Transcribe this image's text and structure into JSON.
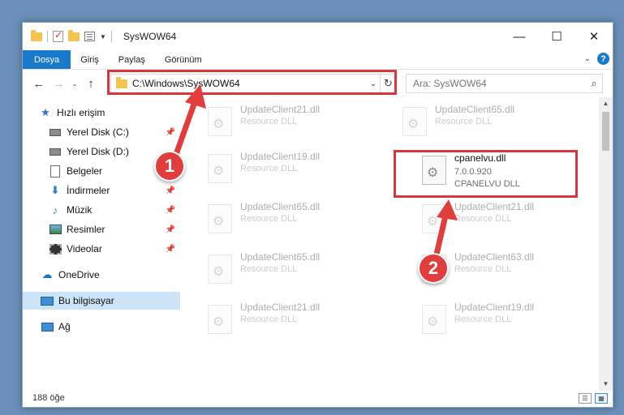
{
  "window": {
    "title": "SysWOW64",
    "controls": {
      "minimize": "—",
      "maximize": "☐",
      "close": "✕"
    }
  },
  "ribbon": {
    "tabs": [
      {
        "label": "Dosya",
        "active": true
      },
      {
        "label": "Giriş"
      },
      {
        "label": "Paylaş"
      },
      {
        "label": "Görünüm"
      }
    ],
    "help": "?"
  },
  "address": {
    "path": "C:\\Windows\\SysWOW64"
  },
  "search": {
    "placeholder": "Ara: SysWOW64"
  },
  "sidebar": {
    "items": [
      {
        "label": "Hızlı erişim",
        "icon": "star-icon"
      },
      {
        "label": "Yerel Disk (C:)",
        "icon": "drive-icon",
        "pinned": true
      },
      {
        "label": "Yerel Disk (D:)",
        "icon": "drive-icon"
      },
      {
        "label": "Belgeler",
        "icon": "document-icon",
        "pinned": true
      },
      {
        "label": "İndirmeler",
        "icon": "download-icon",
        "pinned": true
      },
      {
        "label": "Müzik",
        "icon": "music-icon",
        "pinned": true
      },
      {
        "label": "Resimler",
        "icon": "pictures-icon",
        "pinned": true
      },
      {
        "label": "Videolar",
        "icon": "video-icon",
        "pinned": true
      },
      {
        "label": "OneDrive",
        "icon": "cloud-icon"
      },
      {
        "label": "Bu bilgisayar",
        "icon": "computer-icon",
        "selected": true
      },
      {
        "label": "Ağ",
        "icon": "network-icon"
      }
    ]
  },
  "files": [
    {
      "name": "UpdateClient21.dll",
      "type": "Resource DLL"
    },
    {
      "name": "UpdateClient65.dll",
      "type": "Resource DLL"
    },
    {
      "name": "UpdateClient19.dll",
      "type": "Resource DLL"
    },
    {
      "name": "cpanelvu.dll",
      "version": "7.0.0.920",
      "type": "CPANELVU DLL",
      "highlighted": true
    },
    {
      "name": "UpdateClient65.dll",
      "type": "Resource DLL"
    },
    {
      "name": "UpdateClient21.dll",
      "type": "Resource DLL"
    },
    {
      "name": "UpdateClient65.dll",
      "type": "Resource DLL"
    },
    {
      "name": "UpdateClient63.dll",
      "type": "Resource DLL"
    },
    {
      "name": "UpdateClient21.dll",
      "type": "Resource DLL"
    },
    {
      "name": "UpdateClient19.dll",
      "type": "Resource DLL"
    }
  ],
  "status": {
    "count": "188 öğe"
  },
  "annotations": {
    "step1": "1",
    "step2": "2",
    "color": "#e23d3d"
  }
}
